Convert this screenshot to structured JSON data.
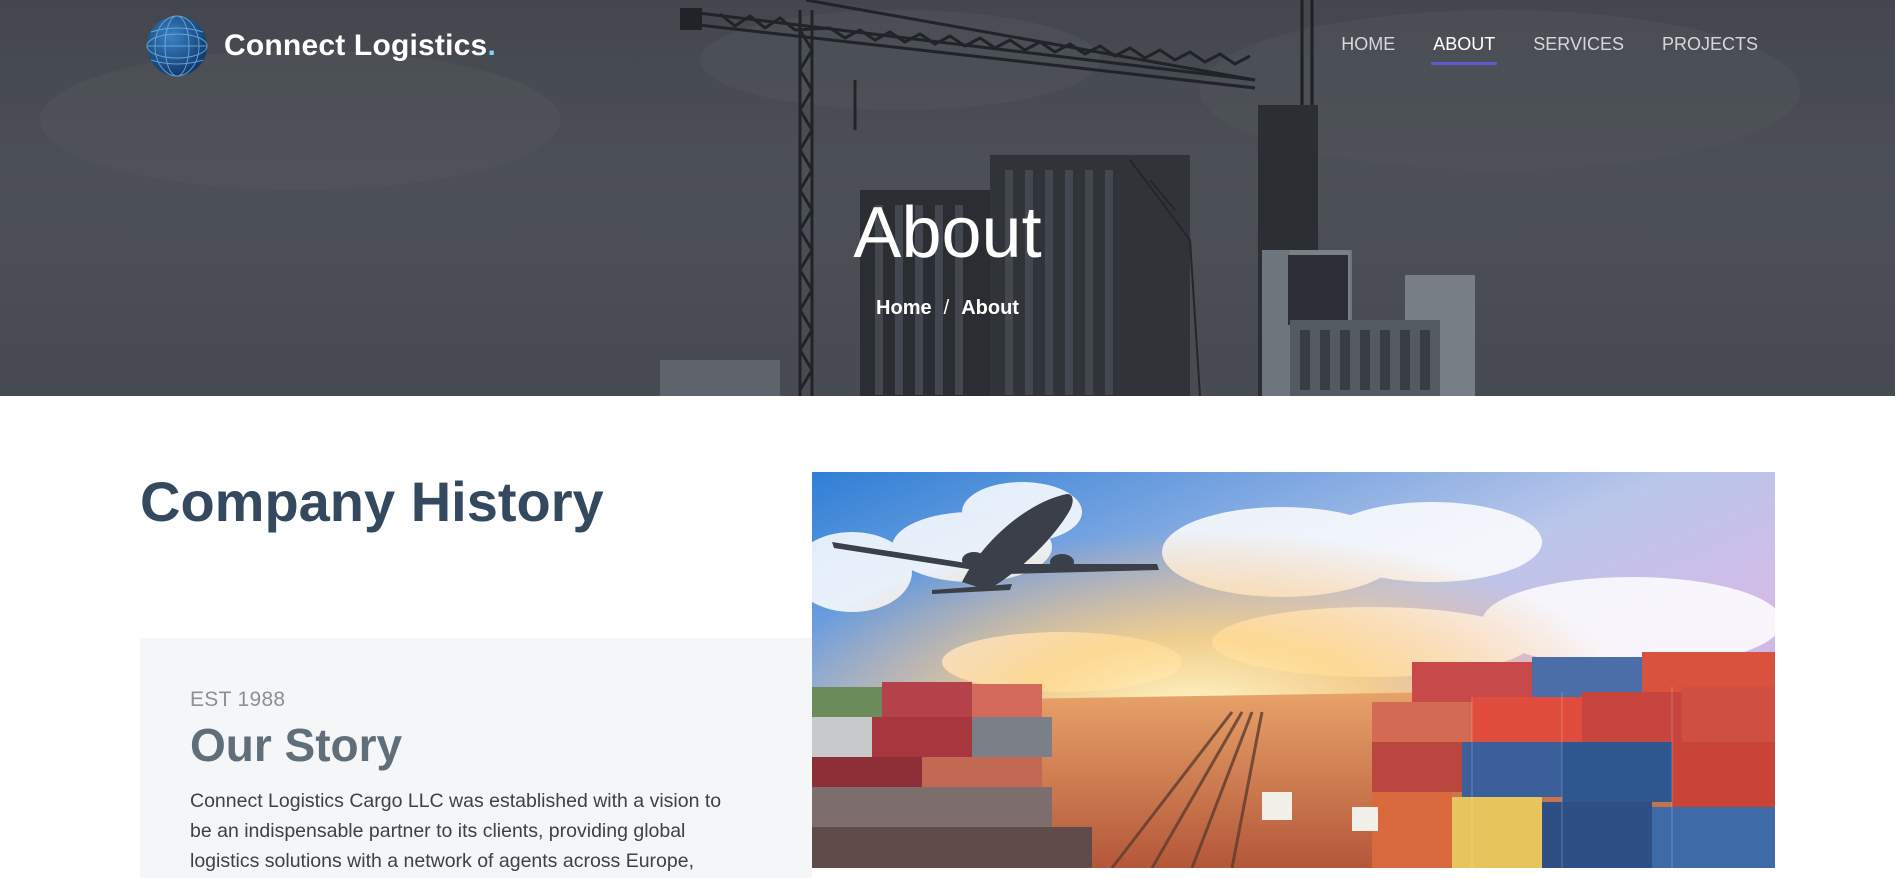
{
  "brand": {
    "name": "Connect Logistics",
    "dot": ".",
    "logo_icon": "globe-icon"
  },
  "nav": {
    "items": [
      {
        "label": "HOME",
        "active": false
      },
      {
        "label": "ABOUT",
        "active": true
      },
      {
        "label": "SERVICES",
        "active": false
      },
      {
        "label": "PROJECTS",
        "active": false
      }
    ],
    "active_indicator_color": "#5b5bd6"
  },
  "hero": {
    "title": "About",
    "breadcrumb": {
      "home": "Home",
      "separator": "/",
      "current": "About"
    }
  },
  "history": {
    "title": "Company History",
    "card": {
      "est": "EST 1988",
      "title": "Our Story",
      "text": "Connect Logistics Cargo LLC was established with a vision to be an indispensable partner to its clients, providing global logistics solutions with a network of agents across Europe,"
    }
  },
  "colors": {
    "heading": "#34495e",
    "card_bg": "#f5f6f8",
    "hero_overlay": "#4f5259"
  }
}
